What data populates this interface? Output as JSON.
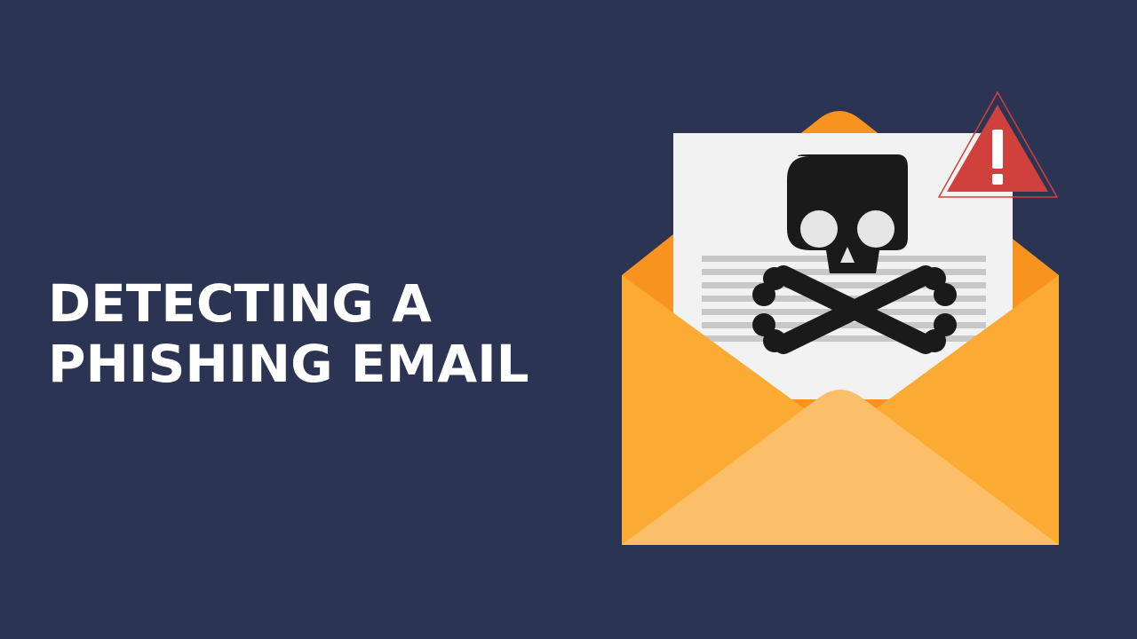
{
  "title": {
    "line1": "DETECTING A",
    "line2": "PHISHING EMAIL"
  },
  "illustration": {
    "envelope_icon": "open-envelope-icon",
    "skull_icon": "skull-and-crossbones-icon",
    "warning_icon": "warning-triangle-icon",
    "colors": {
      "background": "#2b3452",
      "envelope_back": "#f7931e",
      "envelope_front": "#fbab33",
      "envelope_flap": "#fcbf69",
      "paper": "#f2f2f2",
      "text_lines": "#c8c8c8",
      "skull": "#1a1a1a",
      "warning": "#d0413e"
    }
  }
}
